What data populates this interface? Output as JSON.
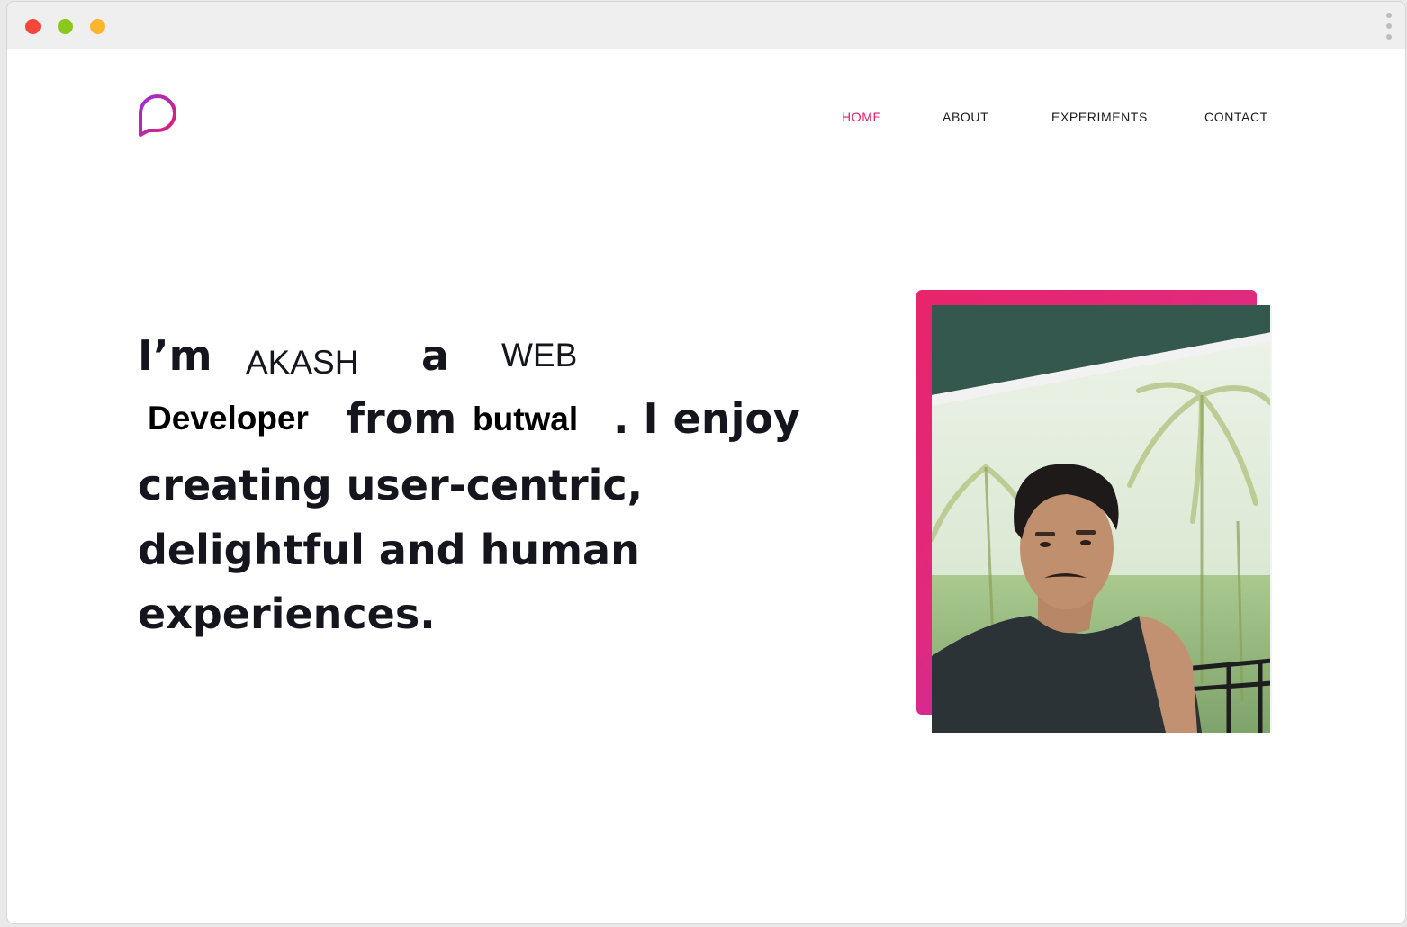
{
  "colors": {
    "accent": "#e2206c",
    "accent_gradient_end": "#b327c8",
    "text": "#15151d",
    "traffic_red": "#f3463c",
    "traffic_green": "#8cc81c",
    "traffic_yellow": "#fbb62b"
  },
  "window": {
    "controls": [
      "close-icon",
      "zoom-icon",
      "minimize-icon"
    ],
    "menu_icon": "kebab-menu-icon"
  },
  "header": {
    "logo_icon": "chat-bubble-logo-icon",
    "nav": [
      {
        "label": "HOME",
        "active": true
      },
      {
        "label": "ABOUT",
        "active": false
      },
      {
        "label": "EXPERIMENTS",
        "active": false
      },
      {
        "label": "CONTACT",
        "active": false
      }
    ]
  },
  "hero": {
    "im": "I’m",
    "name": "AKASH",
    "a": "a",
    "role_1": "WEB",
    "role_2": "Developer",
    "from": "from",
    "place": "butwal",
    "enjoy": ". I enjoy",
    "line_3": "creating user-centric,",
    "line_4": "delightful and human",
    "line_5": "experiences."
  },
  "portrait": {
    "icon": "profile-photo"
  }
}
